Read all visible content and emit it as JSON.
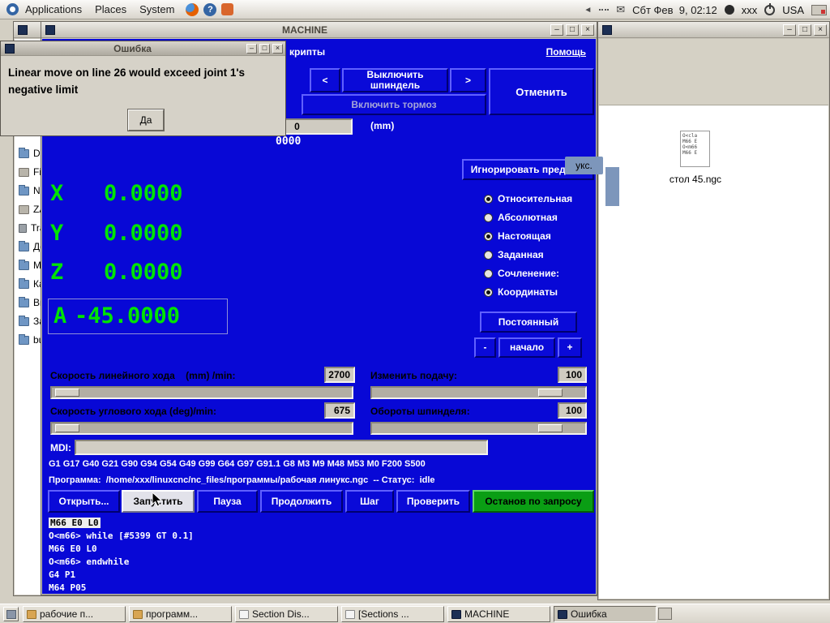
{
  "colors": {
    "cnc_bg": "#0808d6",
    "dro_green": "#00e400",
    "stop_green": "#0a9e14",
    "selection_blue": "#7d96bb"
  },
  "glyphs": {
    "minimize": "–",
    "maximize": "□",
    "close": "×",
    "help_q": "?",
    "envelope": "✉",
    "speaker": "◄"
  },
  "panel": {
    "menu_applications": "Applications",
    "menu_places": "Places",
    "menu_system": "System",
    "clock": "Сбт Фев  9, 02:12",
    "username": "xxx",
    "kb_layout": "USA"
  },
  "dialog": {
    "title": "Ошибка",
    "message": "Linear move on line 26 would exceed joint 1's negative limit",
    "ok_label": "Да"
  },
  "machine": {
    "window_title": "MACHINE",
    "menu_scripts_partial": "крипты",
    "menu_help": "Помощь",
    "btn_prev": "<",
    "btn_spindle_off": "Выключить шпиндель",
    "btn_next": ">",
    "btn_cancel": "Отменить",
    "btn_brake": "Включить тормоз",
    "spin_value": "0",
    "units": "(mm)",
    "partial_value": "0000",
    "btn_ignore_limits": "Игнорировать пределы",
    "dro": [
      {
        "axis": "X",
        "value": "0.0000"
      },
      {
        "axis": "Y",
        "value": "0.0000"
      },
      {
        "axis": "Z",
        "value": "0.0000"
      },
      {
        "axis": "A",
        "value": "-45.0000"
      }
    ],
    "radios": [
      {
        "label": "Относительная",
        "checked": true
      },
      {
        "label": "Абсолютная",
        "checked": false
      },
      {
        "label": "Настоящая",
        "checked": true
      },
      {
        "label": "Заданная",
        "checked": false
      },
      {
        "label": "Сочленение:",
        "checked": false
      },
      {
        "label": "Координаты",
        "checked": true
      }
    ],
    "btn_continuous": "Постоянный",
    "btn_minus": "-",
    "btn_home": "начало",
    "btn_plus": "+",
    "sliders": [
      {
        "label": "Скорость линейного хода    (mm) /min:",
        "value": "2700"
      },
      {
        "label": "Изменить подачу:",
        "value": "100"
      },
      {
        "label": "Скорость углового хода (deg)/min:",
        "value": "675"
      },
      {
        "label": "Обороты шпинделя:",
        "value": "100"
      }
    ],
    "mdi_label": "MDI:",
    "active_gcodes": "G1 G17 G40 G21 G90 G94 G54 G49 G99 G64 G97 G91.1 G8 M3 M9 M48 M53 M0 F200 S500",
    "program_status": "Программа:  /home/xxx/linuxcnc/nc_files/программы/рабочая линукс.ngc  -- Статус:  idle",
    "run_buttons": [
      "Открыть...",
      "Запустить",
      "Пауза",
      "Продолжить",
      "Шаг",
      "Проверить",
      "Останов по запросу"
    ],
    "code_lines": [
      "M66 E0 L0",
      "O<m66> while [#5399 GT 0.1]",
      "M66 E0 L0",
      "O<m66> endwhile",
      "G4 P1",
      "M64 P05"
    ]
  },
  "file_manager": {
    "sidebar_items": [
      "Desk",
      "File",
      "Netw",
      "ZAH",
      "Tras",
      "Док",
      "Муз",
      "Карт",
      "Вид",
      "Загр",
      "build"
    ]
  },
  "desktop": {
    "file_label": "стол 45.ngc",
    "file_preview": [
      "O<cla",
      "M66 E",
      "O<m66",
      "M66 E"
    ],
    "partial_icon_label": "укс."
  },
  "taskbar": {
    "items": [
      "рабочие п...",
      "программ...",
      "Section Dis...",
      "[Sections ...",
      "MACHINE",
      "Ошибка"
    ]
  }
}
